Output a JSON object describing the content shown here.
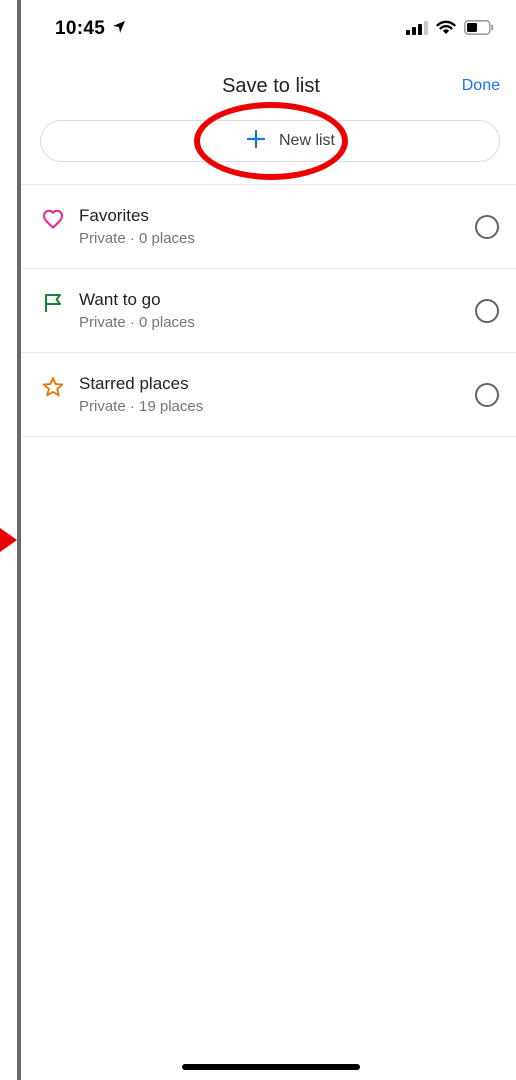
{
  "status_bar": {
    "time": "10:45"
  },
  "header": {
    "title": "Save to list",
    "done_label": "Done"
  },
  "new_list": {
    "label": "New list",
    "icon": "plus-icon"
  },
  "lists": [
    {
      "title": "Favorites",
      "subtitle": "Private · 0 places",
      "icon": "heart-icon",
      "icon_color": "#e52592"
    },
    {
      "title": "Want to go",
      "subtitle": "Private · 0 places",
      "icon": "flag-icon",
      "icon_color": "#188038"
    },
    {
      "title": "Starred places",
      "subtitle": "Private · 19 places",
      "icon": "star-icon",
      "icon_color": "#e8710a"
    }
  ],
  "colors": {
    "accent": "#1a73e8",
    "annotation": "#ee0000"
  }
}
